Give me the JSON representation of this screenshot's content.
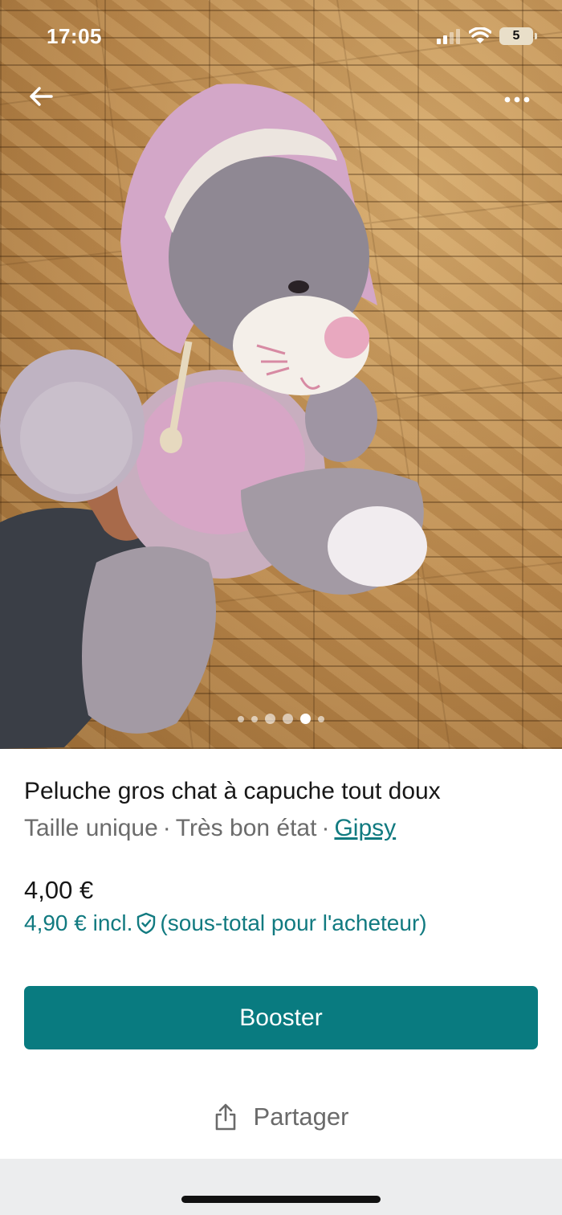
{
  "status_bar": {
    "time": "17:05",
    "battery_level": "5",
    "signal_icon": "cellular-signal-icon",
    "wifi_icon": "wifi-icon"
  },
  "nav": {
    "back_icon": "arrow-left-icon",
    "more_icon": "more-horizontal-icon"
  },
  "carousel": {
    "total_images": 6,
    "active_index": 4
  },
  "item": {
    "title": "Peluche gros chat à capuche tout doux",
    "size": "Taille unique",
    "condition": "Très bon état",
    "separator": "·",
    "brand": "Gipsy",
    "price": "4,00 €",
    "price_incl": "4,90 € incl.",
    "buyer_note": "(sous-total pour l'acheteur)",
    "protection_icon": "shield-check-icon"
  },
  "actions": {
    "boost_label": "Booster",
    "share_label": "Partager",
    "share_icon": "share-icon"
  },
  "colors": {
    "accent": "#097b80",
    "link": "#117a80",
    "text": "#171717",
    "muted": "#6b6b6b"
  }
}
